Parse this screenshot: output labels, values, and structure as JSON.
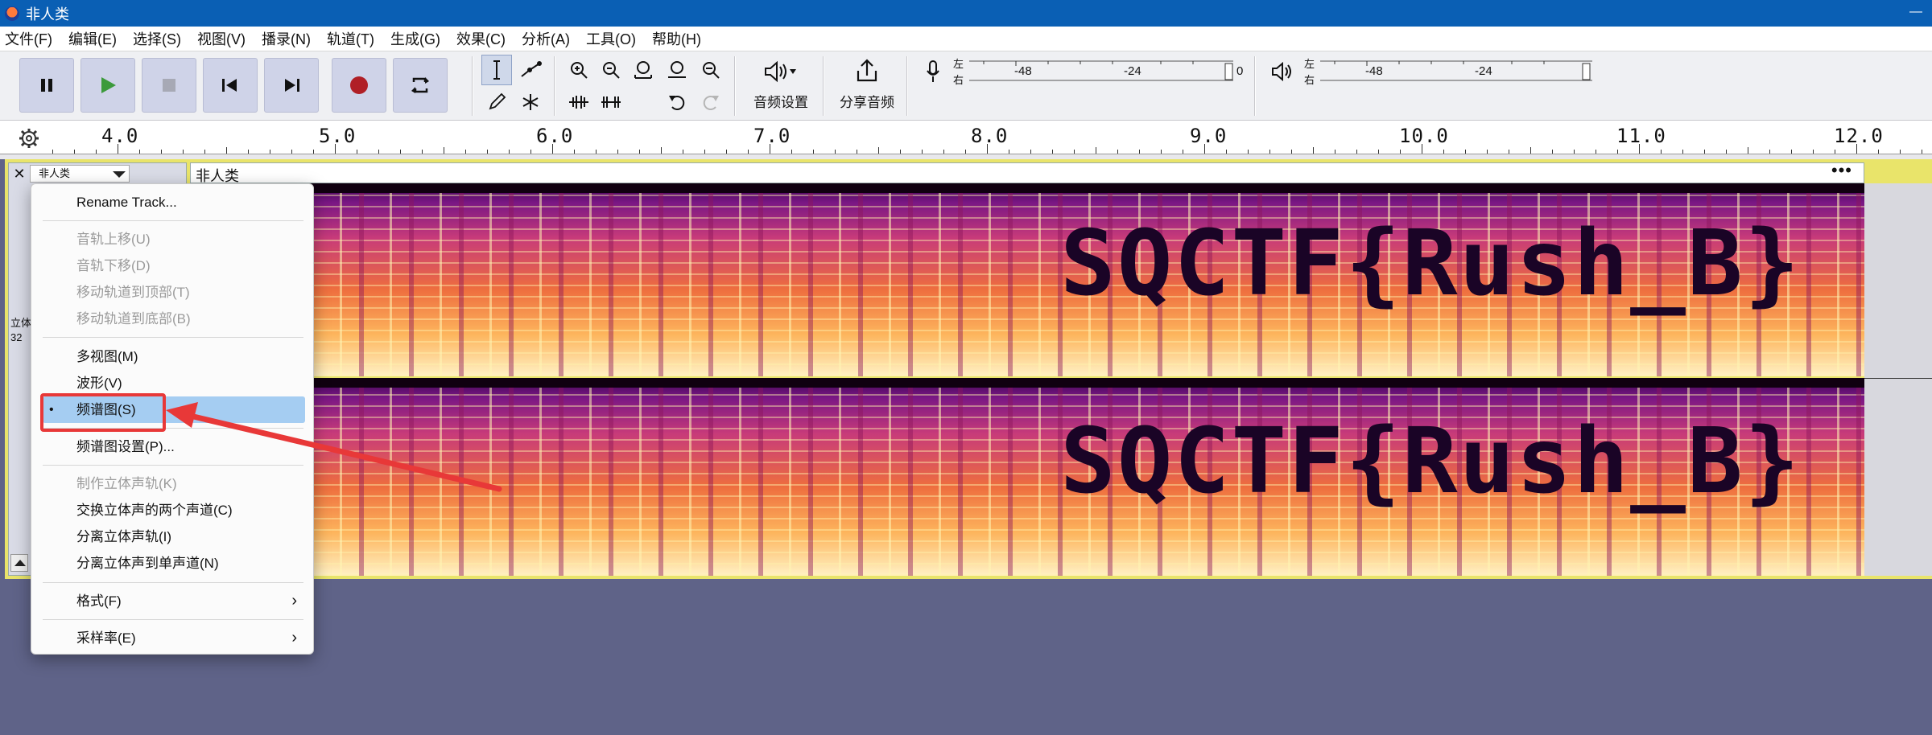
{
  "window": {
    "title": "非人类"
  },
  "menu": [
    "文件(F)",
    "编辑(E)",
    "选择(S)",
    "视图(V)",
    "播录(N)",
    "轨道(T)",
    "生成(G)",
    "效果(C)",
    "分析(A)",
    "工具(O)",
    "帮助(H)"
  ],
  "toolbar": {
    "audio_setup_label": "音频设置",
    "share_audio_label": "分享音频",
    "rec_meter": {
      "left_right": [
        "左",
        "右"
      ],
      "ticks": [
        "-48",
        "-24",
        "0"
      ]
    },
    "play_meter": {
      "left_right": [
        "左",
        "右"
      ],
      "ticks": [
        "-48",
        "-24"
      ]
    }
  },
  "ruler": {
    "labels": [
      "4.0",
      "5.0",
      "6.0",
      "7.0",
      "8.0",
      "9.0",
      "10.0",
      "11.0",
      "12.0"
    ]
  },
  "track": {
    "name": "非人类",
    "clip_name": "非人类",
    "clip_menu": "•••",
    "format_lines": [
      "立体",
      "32"
    ],
    "spectrogram_text": "SQCTF{Rush_B}"
  },
  "context_menu": {
    "items": [
      {
        "label": "Rename Track...",
        "enabled": true
      },
      {
        "label": "音轨上移(U)",
        "enabled": false
      },
      {
        "label": "音轨下移(D)",
        "enabled": false
      },
      {
        "label": "移动轨道到顶部(T)",
        "enabled": false
      },
      {
        "label": "移动轨道到底部(B)",
        "enabled": false
      },
      {
        "label": "多视图(M)",
        "enabled": true
      },
      {
        "label": "波形(V)",
        "enabled": true
      },
      {
        "label": "频谱图(S)",
        "enabled": true,
        "selected": true
      },
      {
        "label": "频谱图设置(P)...",
        "enabled": true
      },
      {
        "label": "制作立体声轨(K)",
        "enabled": false
      },
      {
        "label": "交换立体声的两个声道(C)",
        "enabled": true
      },
      {
        "label": "分离立体声轨(I)",
        "enabled": true
      },
      {
        "label": "分离立体声到单声道(N)",
        "enabled": true
      },
      {
        "label": "格式(F)",
        "enabled": true,
        "submenu": true
      },
      {
        "label": "采样率(E)",
        "enabled": true,
        "submenu": true
      }
    ],
    "selected_bullet": "•",
    "submenu_arrow": "›"
  },
  "colors": {
    "accent": "#0a5fb4",
    "highlight": "#a5cdf2",
    "annotation": "#e83838",
    "background": "#5f6388"
  }
}
